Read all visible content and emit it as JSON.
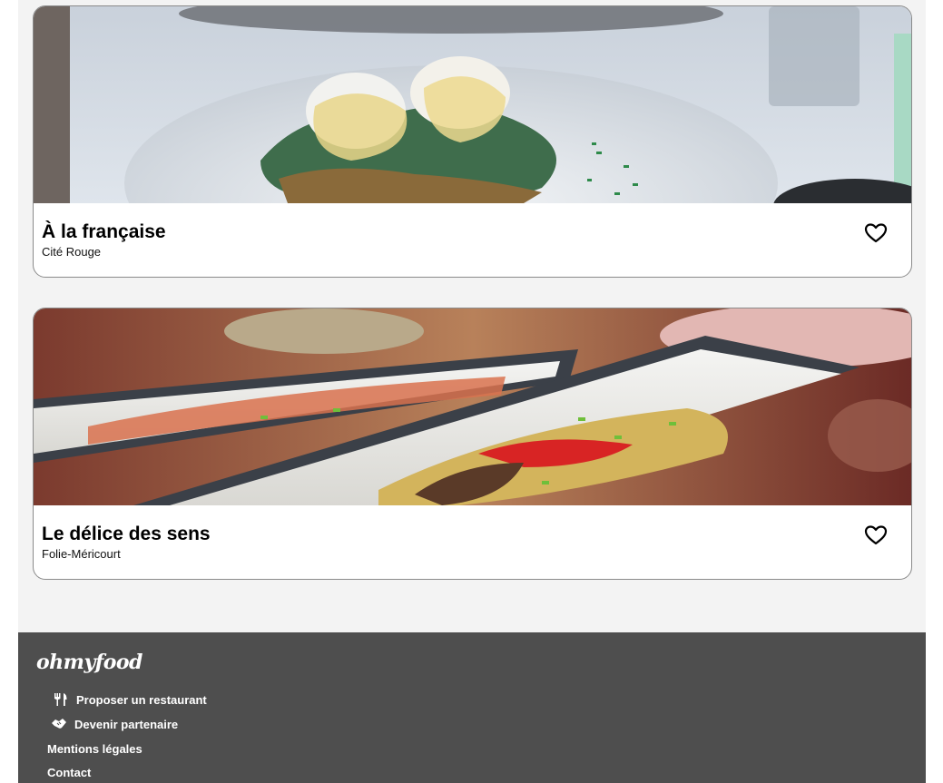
{
  "restaurants": [
    {
      "name": "À la française",
      "location": "Cité Rouge",
      "liked": false
    },
    {
      "name": "Le délice des sens",
      "location": "Folie-Méricourt",
      "liked": false
    }
  ],
  "footer": {
    "brand": "ohmyfood",
    "links": [
      {
        "label": "Proposer un restaurant",
        "icon": "utensils-icon"
      },
      {
        "label": "Devenir partenaire",
        "icon": "handshake-icon"
      },
      {
        "label": "Mentions légales"
      },
      {
        "label": "Contact"
      }
    ]
  },
  "colors": {
    "page_bg": "#f3f3f3",
    "card_border": "#8a8a8a",
    "footer_bg": "#4e4e4e",
    "text": "#000000"
  }
}
